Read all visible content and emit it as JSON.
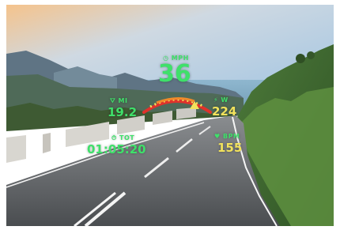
{
  "hud": {
    "speed": {
      "unit": "MPH",
      "value": "36",
      "icon": "speedometer-icon"
    },
    "altitude": {
      "unit": "MI",
      "value": "19.2",
      "icon": "road-icon"
    },
    "power": {
      "unit": "W",
      "value": "224",
      "icon": "bolt-icon"
    },
    "heart_rate": {
      "unit": "BPM",
      "value": "155",
      "icon": "heart-icon"
    },
    "total_time": {
      "unit": "TOT",
      "value": "01:05:20",
      "icon": "clock-icon"
    },
    "gauge_level": 0.55
  },
  "colors": {
    "hud_green": "#3fe06a",
    "hud_yellow": "#f2e25c",
    "gauge_red": "#e0322b",
    "gauge_orange": "#f08a2a"
  }
}
